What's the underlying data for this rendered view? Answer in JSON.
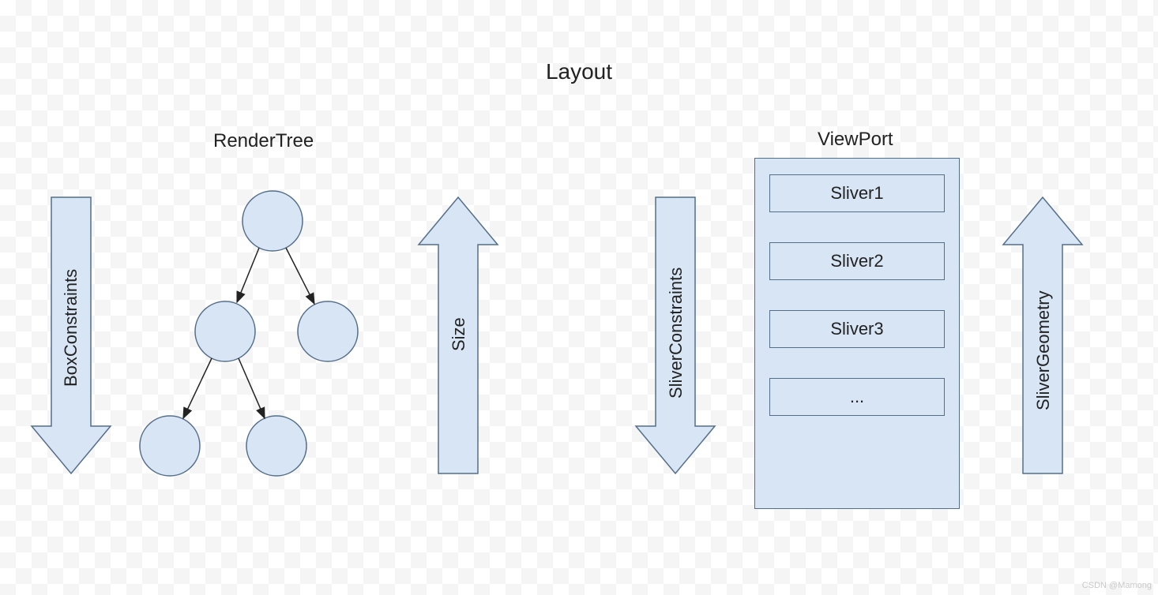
{
  "title": "Layout",
  "left": {
    "heading": "RenderTree",
    "arrow_down_label": "BoxConstraints",
    "arrow_up_label": "Size"
  },
  "right": {
    "heading": "ViewPort",
    "arrow_down_label": "SliverConstraints",
    "arrow_up_label": "SliverGeometry",
    "slivers": [
      "Sliver1",
      "Sliver2",
      "Sliver3",
      "..."
    ]
  },
  "watermark": "CSDN @Mamong",
  "colors": {
    "shape_fill": "#d7e5f4",
    "shape_stroke": "#546e8a"
  }
}
